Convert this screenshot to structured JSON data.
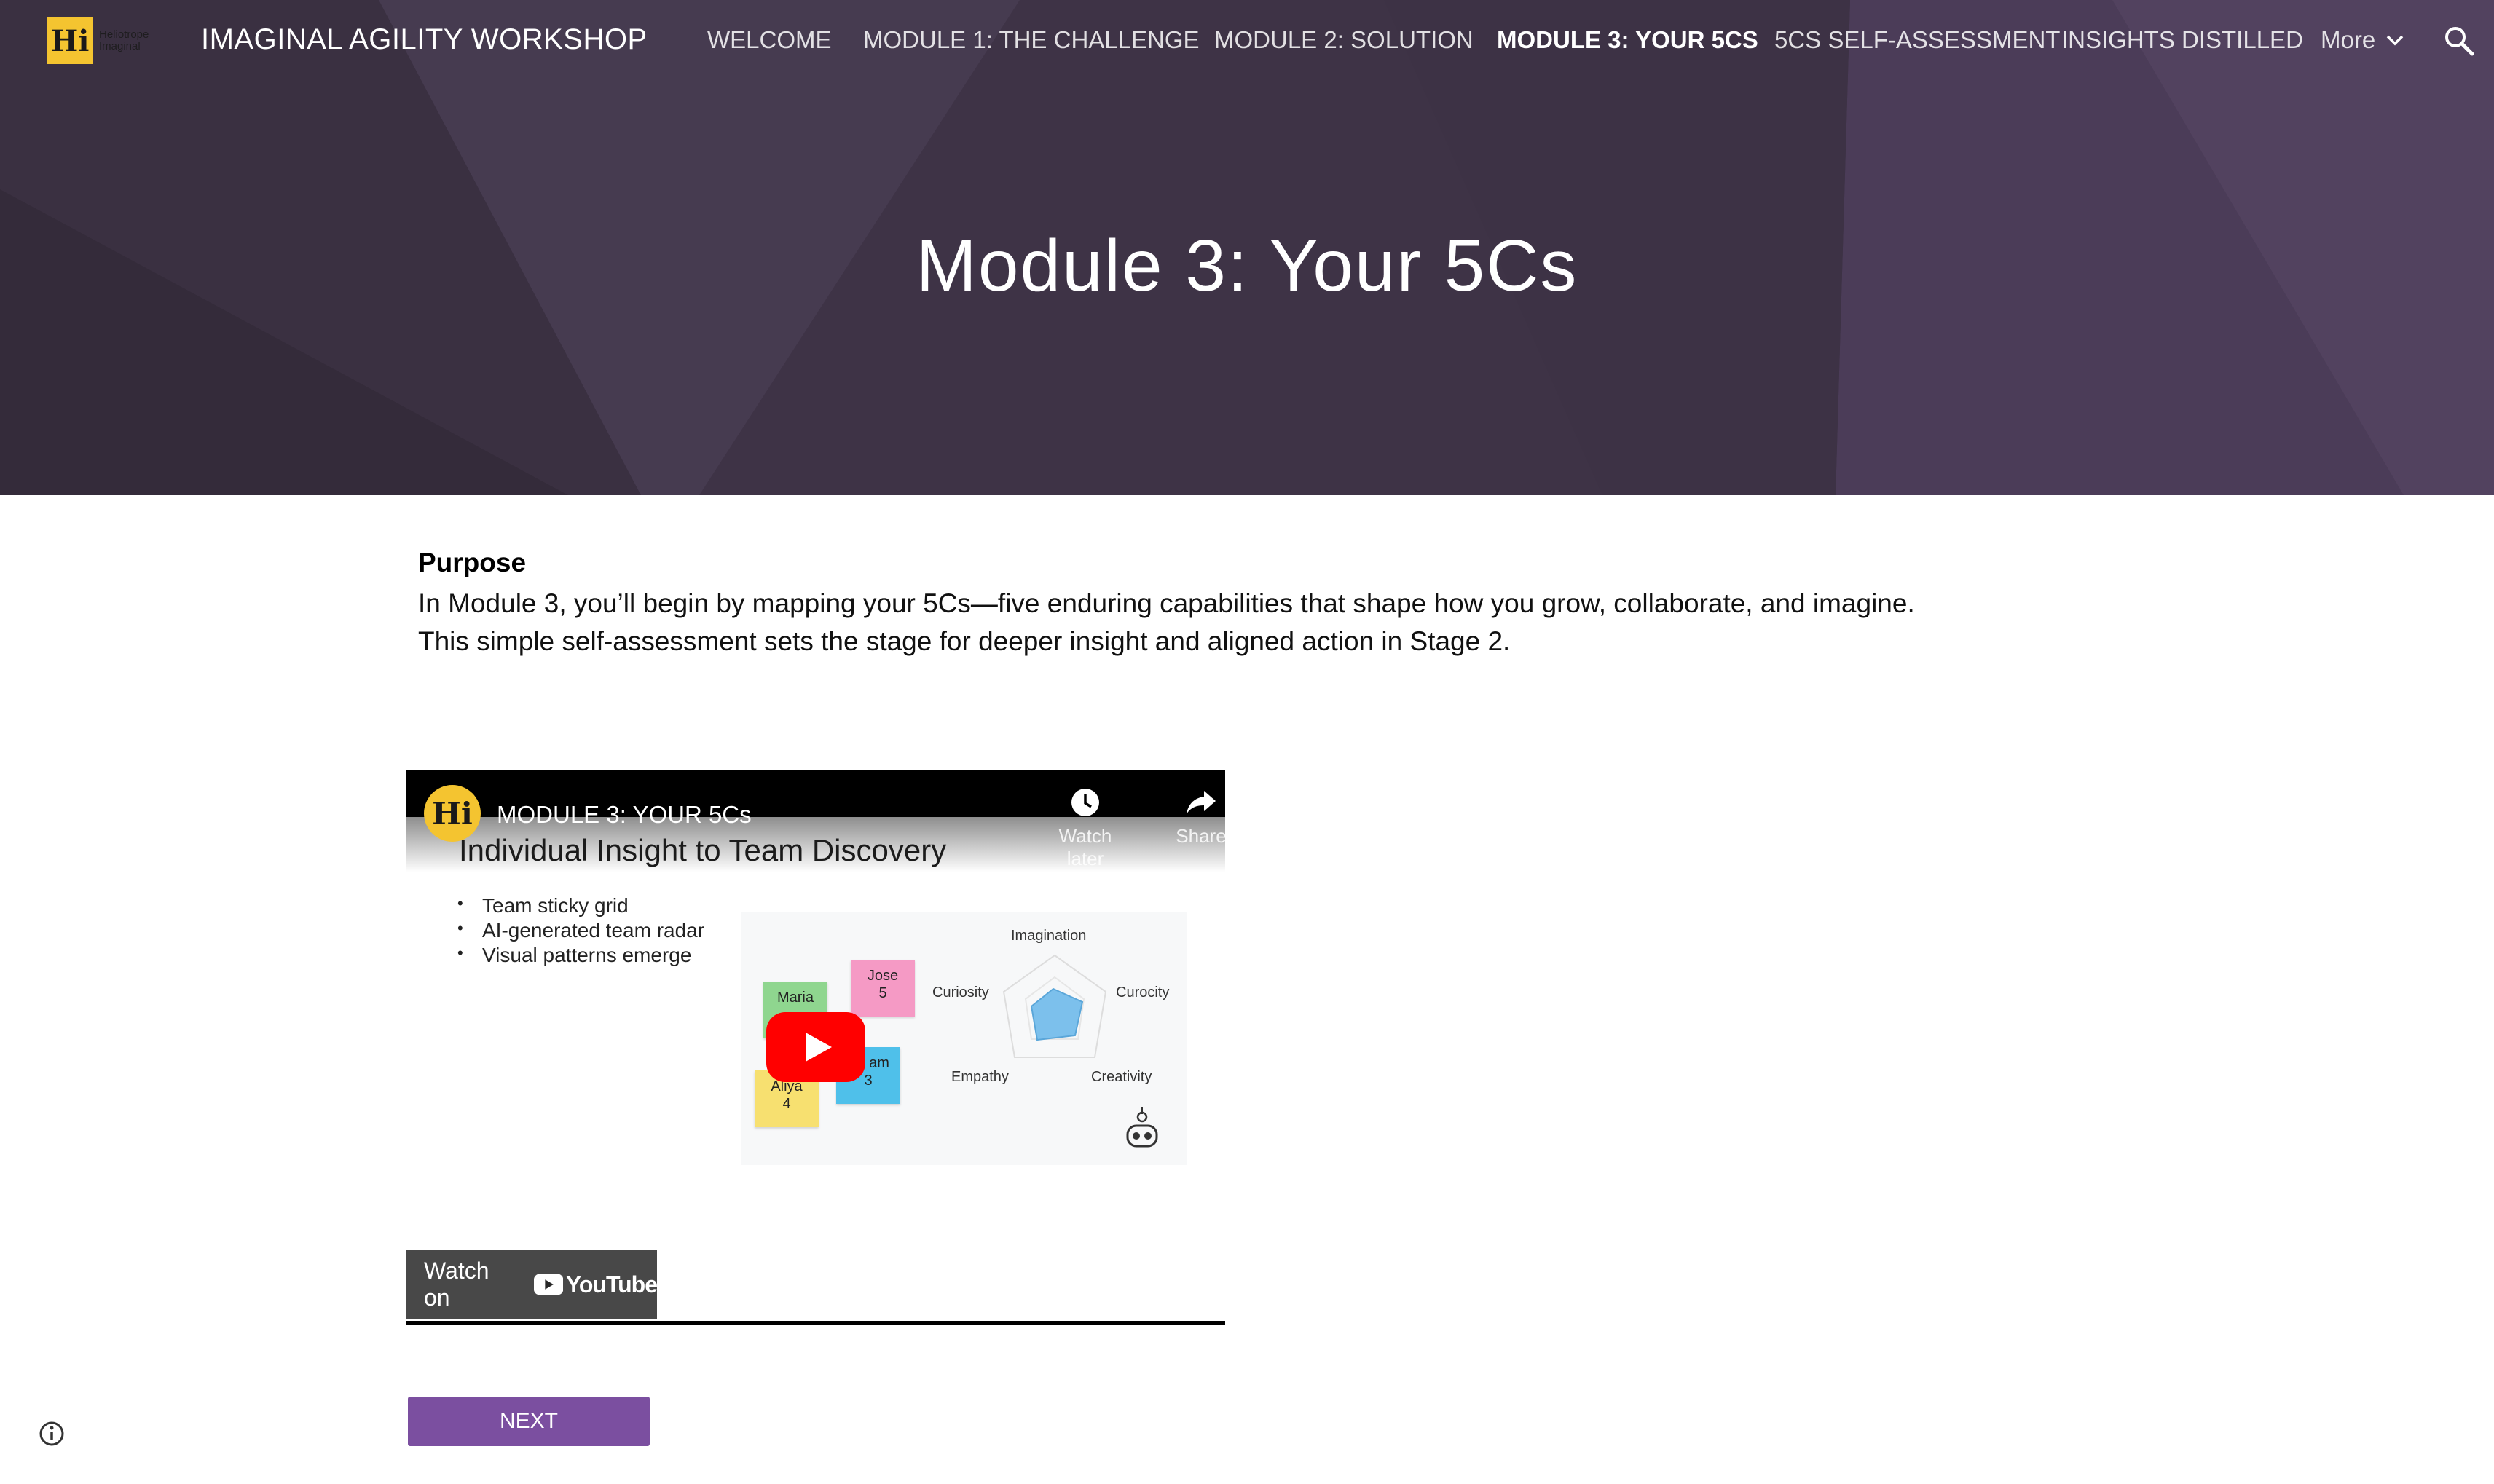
{
  "site": {
    "logo_letters": "Hi",
    "logo_subtext_1": "Heliotrope",
    "logo_subtext_2": "Imaginal",
    "title": "IMAGINAL AGILITY WORKSHOP"
  },
  "nav": {
    "items": [
      {
        "label": "WELCOME",
        "active": false
      },
      {
        "label": "MODULE 1: THE CHALLENGE",
        "active": false
      },
      {
        "label": "MODULE 2: SOLUTION",
        "active": false
      },
      {
        "label": "MODULE 3: YOUR 5CS",
        "active": true
      },
      {
        "label": "5CS SELF-ASSESSMENT",
        "active": false
      },
      {
        "label": "INSIGHTS DISTILLED",
        "active": false
      }
    ],
    "more_label": "More",
    "icons": {
      "more": "chevron-down-icon",
      "search": "search-icon"
    }
  },
  "hero": {
    "title": "Module 3: Your 5Cs",
    "background_color": "#3e3346"
  },
  "content": {
    "purpose_heading": "Purpose",
    "purpose_lines": [
      "In Module 3, you’ll begin by mapping your 5Cs—five enduring capabilities that shape how you grow, collaborate, and imagine.",
      "This simple self-assessment sets the stage for deeper insight and aligned action in Stage 2."
    ]
  },
  "video": {
    "channel_logo": "Hi",
    "title": "MODULE 3: YOUR 5Cs",
    "watch_later": "Watch later",
    "share": "Share",
    "slide": {
      "heading": "Individual Insight to Team Discovery",
      "bullets": [
        "Team sticky grid",
        "AI-generated team radar",
        "Visual patterns emerge"
      ],
      "stickies": [
        {
          "name": "Maria",
          "value": ""
        },
        {
          "name": "Jose",
          "value": "5"
        },
        {
          "name": "am",
          "value": "3"
        },
        {
          "name": "Aliya",
          "value": "4"
        }
      ],
      "radar_labels": [
        "Imagination",
        "Curiosity",
        "Curocity",
        "Empathy",
        "Creativity"
      ]
    },
    "watch_on": "Watch on",
    "youtube": "YouTube",
    "play_color": "#ff0000"
  },
  "footer": {
    "next_label": "NEXT",
    "next_color": "#7b4fa0",
    "info_icon": "info-icon"
  }
}
